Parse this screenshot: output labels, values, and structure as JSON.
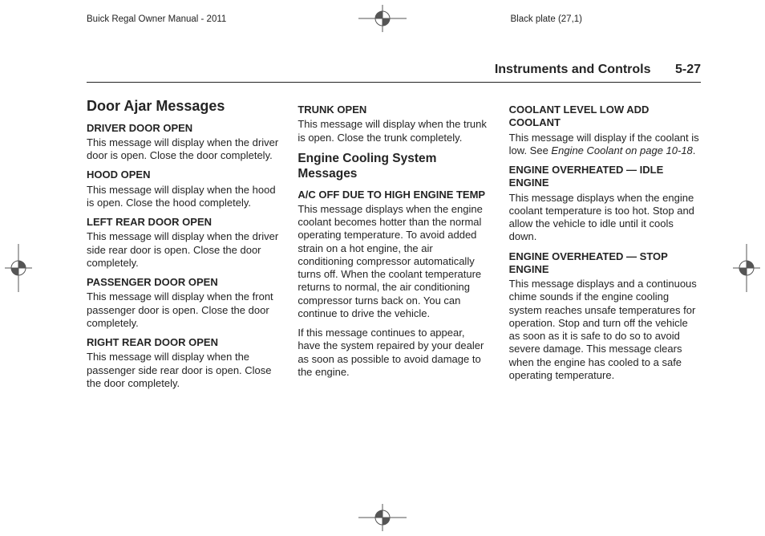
{
  "meta": {
    "manual": "Buick Regal Owner Manual - 2011",
    "plate": "Black plate (27,1)"
  },
  "runhead": {
    "section": "Instruments and Controls",
    "pageno": "5-27"
  },
  "col1": {
    "h1": "Door Ajar Messages",
    "items": [
      {
        "title": "DRIVER DOOR OPEN",
        "body": "This message will display when the driver door is open. Close the door completely."
      },
      {
        "title": "HOOD OPEN",
        "body": "This message will display when the hood is open. Close the hood completely."
      },
      {
        "title": "LEFT REAR DOOR OPEN",
        "body": "This message will display when the driver side rear door is open. Close the door completely."
      },
      {
        "title": "PASSENGER DOOR OPEN",
        "body": "This message will display when the front passenger door is open. Close the door completely."
      },
      {
        "title": "RIGHT REAR DOOR OPEN",
        "body": "This message will display when the passenger side rear door is open. Close the door completely."
      }
    ]
  },
  "col2": {
    "lead": {
      "title": "TRUNK OPEN",
      "body": "This message will display when the trunk is open. Close the trunk completely."
    },
    "h2": "Engine Cooling System Messages",
    "ac": {
      "title": "A/C OFF DUE TO HIGH ENGINE TEMP",
      "body1": "This message displays when the engine coolant becomes hotter than the normal operating temperature. To avoid added strain on a hot engine, the air conditioning compressor automatically turns off. When the coolant temperature returns to normal, the air conditioning compressor turns back on. You can continue to drive the vehicle.",
      "body2": "If this message continues to appear, have the system repaired by your dealer as soon as possible to avoid damage to the engine."
    }
  },
  "col3": {
    "low": {
      "title": "COOLANT LEVEL LOW ADD COOLANT",
      "body_pre": "This message will display if the coolant is low. See ",
      "xref": "Engine Coolant on page 10-18",
      "body_post": "."
    },
    "idle": {
      "title": "ENGINE OVERHEATED — IDLE ENGINE",
      "body": "This message displays when the engine coolant temperature is too hot. Stop and allow the vehicle to idle until it cools down."
    },
    "stop": {
      "title": "ENGINE OVERHEATED — STOP ENGINE",
      "body": "This message displays and a continuous chime sounds if the engine cooling system reaches unsafe temperatures for operation. Stop and turn off the vehicle as soon as it is safe to do so to avoid severe damage. This message clears when the engine has cooled to a safe operating temperature."
    }
  }
}
